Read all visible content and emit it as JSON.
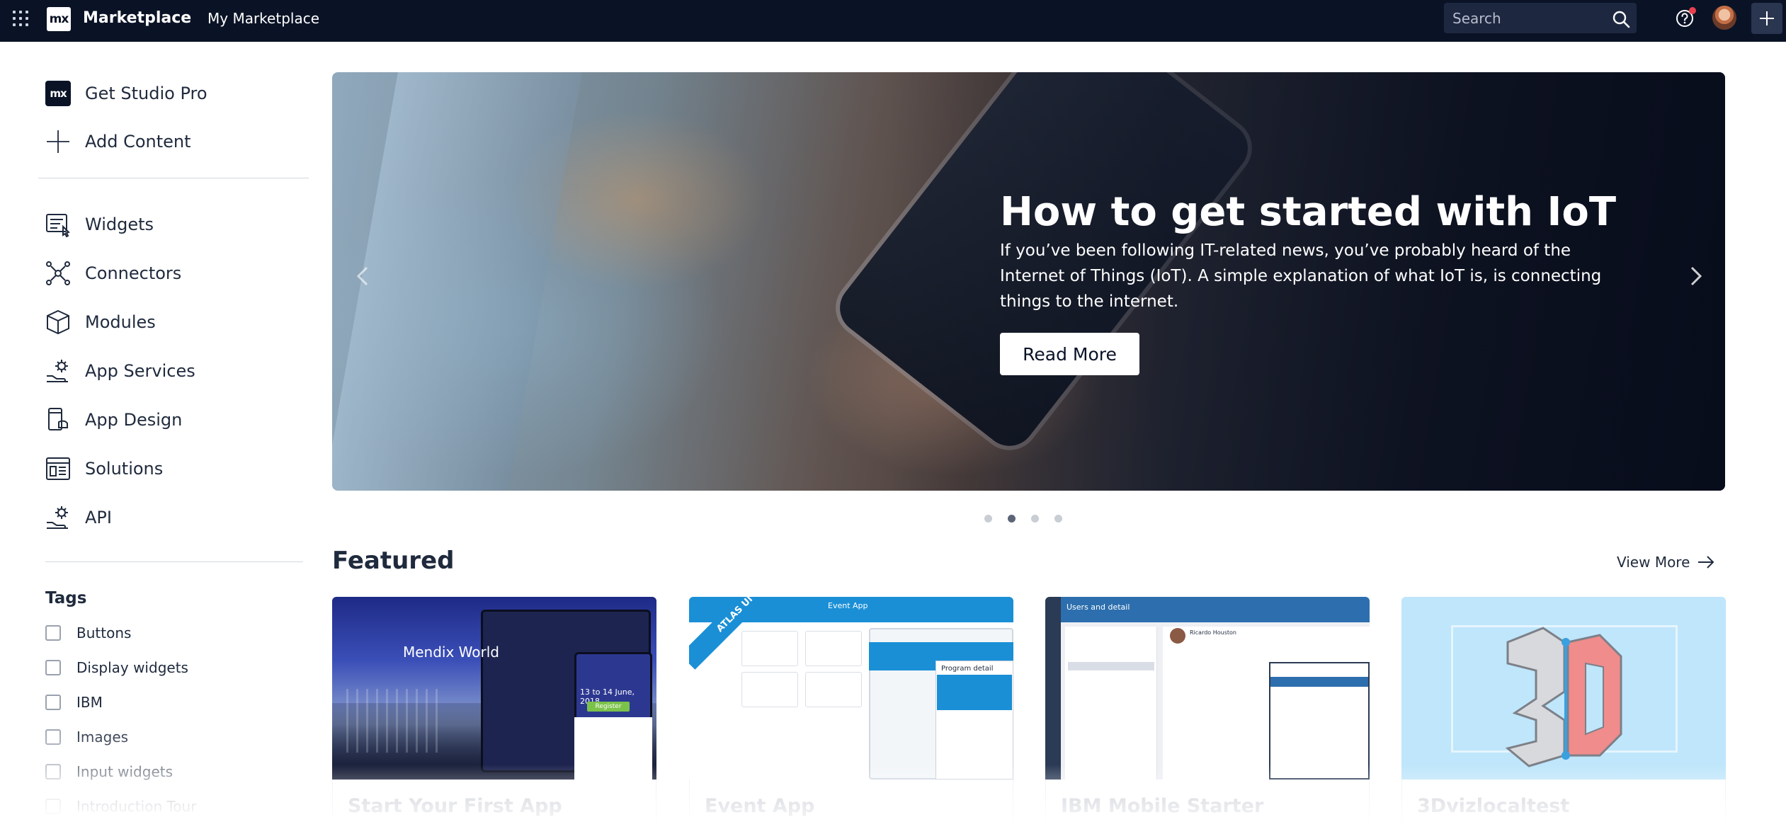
{
  "topbar": {
    "brand_logo": "mx",
    "brand": "Marketplace",
    "my_marketplace": "My Marketplace",
    "search_placeholder": "Search"
  },
  "sidebar": {
    "get_studio_pro": "Get Studio Pro",
    "add_content": "Add Content",
    "categories": [
      {
        "label": "Widgets",
        "icon": "widgets-icon"
      },
      {
        "label": "Connectors",
        "icon": "connectors-icon"
      },
      {
        "label": "Modules",
        "icon": "modules-icon"
      },
      {
        "label": "App Services",
        "icon": "app-services-icon"
      },
      {
        "label": "App Design",
        "icon": "app-design-icon"
      },
      {
        "label": "Solutions",
        "icon": "solutions-icon"
      },
      {
        "label": "API",
        "icon": "api-icon"
      }
    ],
    "tags_title": "Tags",
    "tags": [
      "Buttons",
      "Display widgets",
      "IBM",
      "Images",
      "Input widgets",
      "Introduction Tour"
    ]
  },
  "hero": {
    "title": "How to get started with IoT",
    "text": "If you’ve been following IT-related news, you’ve probably heard of the Internet of Things (IoT). A simple explanation of what IoT is, is connecting things to the internet.",
    "button": "Read More",
    "slide_count": 4,
    "active_slide": 2
  },
  "featured": {
    "title": "Featured",
    "view_more": "View More",
    "cards": [
      {
        "title": "Start Your First App",
        "thumb_text": "Mendix World",
        "thumb_sub": "13 to 14 June, 2018",
        "thumb_button": "Register"
      },
      {
        "title": "Event App",
        "thumb_text": "Event App",
        "ribbon": "ATLAS UI",
        "thumb_sub": "Program detail"
      },
      {
        "title": "IBM Mobile Starter",
        "thumb_text": "Users and detail",
        "thumb_sub": "Ricardo Houston"
      },
      {
        "title": "3Dvizlocaltest",
        "thumb_text": "3D"
      }
    ]
  },
  "colors": {
    "topbar": "#0a1326",
    "accent": "#0a1326",
    "notification": "#e8404f"
  }
}
